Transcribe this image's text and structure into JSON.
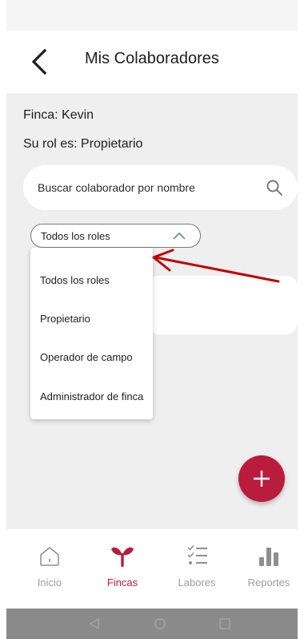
{
  "header": {
    "title": "Mis Colaboradores"
  },
  "farm": {
    "farm_text": "Finca: Kevin",
    "role_text": "Su rol es: Propietario"
  },
  "search": {
    "placeholder": "Buscar colaborador por nombre"
  },
  "role_filter": {
    "selected": "Todos los roles",
    "options": [
      "Todos los roles",
      "Propietario",
      "Operador de campo",
      "Administrador de finca"
    ]
  },
  "bottom_nav": {
    "items": [
      {
        "label": "Inicio",
        "icon": "home-icon",
        "active": false
      },
      {
        "label": "Fincas",
        "icon": "sprout-icon",
        "active": true
      },
      {
        "label": "Labores",
        "icon": "checklist-icon",
        "active": false
      },
      {
        "label": "Reportes",
        "icon": "bar-chart-icon",
        "active": false
      }
    ]
  },
  "colors": {
    "accent": "#b91c3c",
    "annotation_arrow": "#c00000",
    "inactive": "#9e9e9e",
    "content_bg": "#efefef"
  }
}
